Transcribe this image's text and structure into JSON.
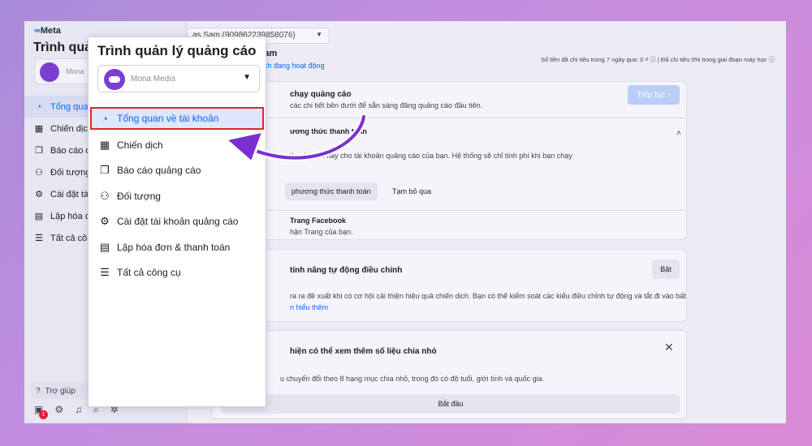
{
  "brand": {
    "logo_symbol": "∞",
    "logo_text": "Meta"
  },
  "sidebar": {
    "title": "Trình quả",
    "account_name": "Mona",
    "items": [
      {
        "label": "Tổng quan",
        "icon": "gauge-icon",
        "active": true
      },
      {
        "label": "Chiến dịch",
        "icon": "table-icon"
      },
      {
        "label": "Báo cáo q",
        "icon": "report-icon"
      },
      {
        "label": "Đối tượng",
        "icon": "people-icon"
      },
      {
        "label": "Cài đặt tài",
        "icon": "settings-icon"
      },
      {
        "label": "Lập hóa đ",
        "icon": "billing-icon"
      },
      {
        "label": "Tất cả côn",
        "icon": "menu-icon"
      }
    ],
    "help_label": "Trợ giúp",
    "notification_count": "1"
  },
  "header": {
    "account_select": "as Sam (909862239858076)",
    "account_name": "Sam",
    "account_status": "dịch đang hoạt động",
    "spend_text": "Số tiền đã chi tiêu trong 7 ngày qua: 0 ₫ ⓘ | Đã chi tiêu 0% trong giai đoạn máy học ⓘ"
  },
  "card_setup": {
    "title": "chạy quảng cáo",
    "subtitle": "các chi tiết bên dưới để sẵn sàng đăng quảng cáo đầu tiên.",
    "continue_label": "Tiếp tục",
    "payment_title": "ương thức thanh toán",
    "payment_desc": "thanh toán này cho tài khoản quảng cáo của bạn. Hệ thống sẽ chỉ tính phí khi bạn chạy",
    "add_payment_label": "phương thức thanh toán",
    "skip_label": "Tạm bỏ qua",
    "page_title": "Trang Facebook",
    "page_desc": "hận Trang của bạn."
  },
  "card_auto": {
    "title": "tính năng tự động điều chỉnh",
    "toggle_label": "Bật",
    "desc": "ra ra đề xuất khi có cơ hội cải thiện hiệu quả chiến dịch. Bạn có thể kiểm soát các kiểu điều chỉnh tự động và tắt đi vào bất",
    "learn_more": "n hiểu thêm"
  },
  "card_breakdown": {
    "title": "hiện có thể xem thêm số liệu chia nhỏ",
    "desc": "u chuyển đổi theo 8 hạng mục chia nhỏ, trong đó có độ tuổi, giới tính và quốc gia.",
    "start_label": "Bắt đầu"
  },
  "popup": {
    "title": "Trình quản lý quảng cáo",
    "account_name": "Mona Media",
    "items": [
      {
        "label": "Tổng quan về tài khoản",
        "icon": "gauge-icon",
        "active": true
      },
      {
        "label": "Chiến dịch",
        "icon": "table-icon"
      },
      {
        "label": "Báo cáo quảng cáo",
        "icon": "report-icon"
      },
      {
        "label": "Đối tượng",
        "icon": "people-icon"
      },
      {
        "label": "Cài đặt tài khoản quảng cáo",
        "icon": "settings-icon"
      },
      {
        "label": "Lập hóa đơn & thanh toán",
        "icon": "billing-icon"
      },
      {
        "label": "Tất cả công cụ",
        "icon": "menu-icon"
      }
    ]
  },
  "colors": {
    "accent": "#0866ff",
    "highlight_border": "#e0262b",
    "arrow": "#7b2fd0"
  }
}
